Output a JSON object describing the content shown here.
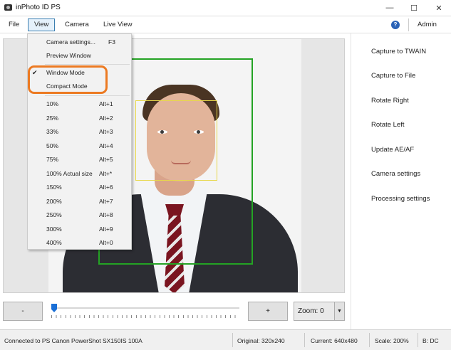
{
  "window": {
    "title": "inPhoto ID PS",
    "minimize": "—",
    "maximize": "☐",
    "close": "✕"
  },
  "menubar": {
    "items": [
      "File",
      "View",
      "Camera",
      "Live View"
    ],
    "user": "Admin",
    "help": "?"
  },
  "view_menu": {
    "top_items": [
      {
        "label": "Camera settings...",
        "shortcut": "F3"
      },
      {
        "label": "Preview Window",
        "shortcut": ""
      }
    ],
    "mode_items": [
      {
        "label": "Window Mode",
        "checked": true,
        "check": "✔"
      },
      {
        "label": "Compact Mode",
        "checked": false
      }
    ],
    "zoom_items": [
      {
        "label": "10%",
        "shortcut": "Alt+1"
      },
      {
        "label": "25%",
        "shortcut": "Alt+2"
      },
      {
        "label": "33%",
        "shortcut": "Alt+3"
      },
      {
        "label": "50%",
        "shortcut": "Alt+4"
      },
      {
        "label": "75%",
        "shortcut": "Alt+5"
      },
      {
        "label": "100% Actual size",
        "shortcut": "Alt+*"
      },
      {
        "label": "150%",
        "shortcut": "Alt+6"
      },
      {
        "label": "200%",
        "shortcut": "Alt+7"
      },
      {
        "label": "250%",
        "shortcut": "Alt+8"
      },
      {
        "label": "300%",
        "shortcut": "Alt+9"
      },
      {
        "label": "400%",
        "shortcut": "Alt+0"
      }
    ]
  },
  "controls": {
    "minus": "-",
    "plus": "+",
    "zoom_value": "Zoom: 0",
    "zoom_dropdown": "▼",
    "slider_value": 0
  },
  "actions": [
    "Capture to TWAIN",
    "Capture to File",
    "Rotate Right",
    "Rotate Left",
    "Update AE/AF",
    "Camera settings",
    "Processing settings"
  ],
  "status": {
    "connection": "Connected to PS Canon PowerShot SX150IS 100A",
    "original": "Original: 320x240",
    "current": "Current: 640x480",
    "scale": "Scale: 200%",
    "b": "B: DC"
  },
  "colors": {
    "face_frame": "#24a324",
    "eye_frame": "#e8d84a",
    "highlight": "#ec7a22",
    "accent": "#1a6fd6"
  }
}
